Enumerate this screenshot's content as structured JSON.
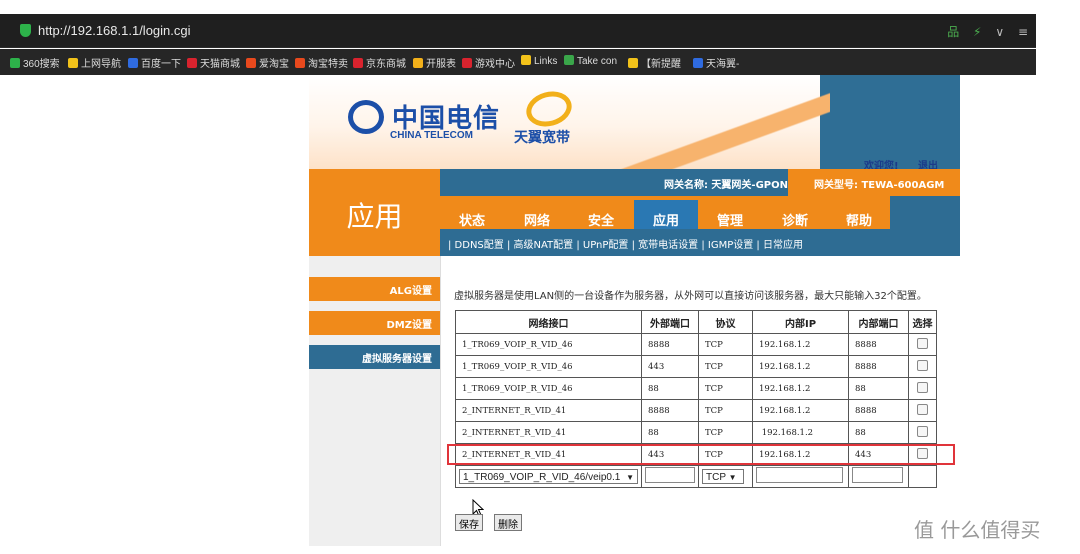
{
  "browser": {
    "url": "http://192.168.1.1/login.cgi",
    "right_icons": [
      "品",
      "⚡",
      "∨",
      "≡"
    ],
    "bookmarks": [
      {
        "label": "360搜索",
        "color": "#2db24a"
      },
      {
        "label": "上网导航",
        "color": "#f2c21a"
      },
      {
        "label": "百度一下",
        "color": "#2f6be0"
      },
      {
        "label": "天猫商城",
        "color": "#d9232e"
      },
      {
        "label": "爱淘宝",
        "color": "#e8491d"
      },
      {
        "label": "淘宝特卖",
        "color": "#e8491d"
      },
      {
        "label": "京东商城",
        "color": "#d9232e"
      },
      {
        "label": "开服表",
        "color": "#f2b01a"
      },
      {
        "label": "游戏中心",
        "color": "#d9232e"
      },
      {
        "label": "Links",
        "color": "#f2c21a"
      },
      {
        "label": "Take con",
        "color": "#3aa64a"
      },
      {
        "label": "【新提醒",
        "color": "#f2c21a"
      },
      {
        "label": "天海翼-",
        "color": "#2f6be0"
      }
    ]
  },
  "header": {
    "logo_cn": "中国电信",
    "logo_en": "CHINA TELECOM",
    "brand": "天翼宽带",
    "welcome": "欢迎您!",
    "logout": "退出",
    "gateway_name": "网关名称: 天翼网关-GPON",
    "gateway_model": "网关型号: TEWA-600AGM",
    "section_title": "应用"
  },
  "tabs": [
    "状态",
    "网络",
    "安全",
    "应用",
    "管理",
    "诊断",
    "帮助"
  ],
  "active_tab": "应用",
  "subnav": "| DDNS配置 | 高级NAT配置 | UPnP配置 | 宽带电话设置 | IGMP设置 | 日常应用",
  "sidebar": [
    {
      "label": "ALG设置",
      "color": "#f08a1a"
    },
    {
      "label": "DMZ设置",
      "color": "#f08a1a"
    },
    {
      "label": "虚拟服务器设置",
      "color": "#2e6c93"
    }
  ],
  "main": {
    "description": "虚拟服务器是使用LAN侧的一台设备作为服务器，从外网可以直接访问该服务器，最大只能输入32个配置。",
    "columns": [
      "网络接口",
      "外部端口",
      "协议",
      "内部IP",
      "内部端口",
      "选择"
    ],
    "rows": [
      {
        "iface": "1_TR069_VOIP_R_VID_46",
        "ext": "8888",
        "proto": "TCP",
        "ip": "192.168.1.2",
        "int": "8888"
      },
      {
        "iface": "1_TR069_VOIP_R_VID_46",
        "ext": "443",
        "proto": "TCP",
        "ip": "192.168.1.2",
        "int": "8888"
      },
      {
        "iface": "1_TR069_VOIP_R_VID_46",
        "ext": "88",
        "proto": "TCP",
        "ip": "192.168.1.2",
        "int": "88"
      },
      {
        "iface": "2_INTERNET_R_VID_41",
        "ext": "8888",
        "proto": "TCP",
        "ip": "192.168.1.2",
        "int": "8888"
      },
      {
        "iface": "2_INTERNET_R_VID_41",
        "ext": "88",
        "proto": "TCP",
        "ip": " 192.168.1.2",
        "int": "88"
      },
      {
        "iface": "2_INTERNET_R_VID_41",
        "ext": "443",
        "proto": "TCP",
        "ip": "192.168.1.2",
        "int": "443"
      }
    ],
    "new_row": {
      "iface_select": "1_TR069_VOIP_R_VID_46/veip0.1",
      "proto_select": "TCP"
    },
    "save_label": "保存",
    "delete_label": "删除"
  },
  "watermark": "值 什么值得买"
}
